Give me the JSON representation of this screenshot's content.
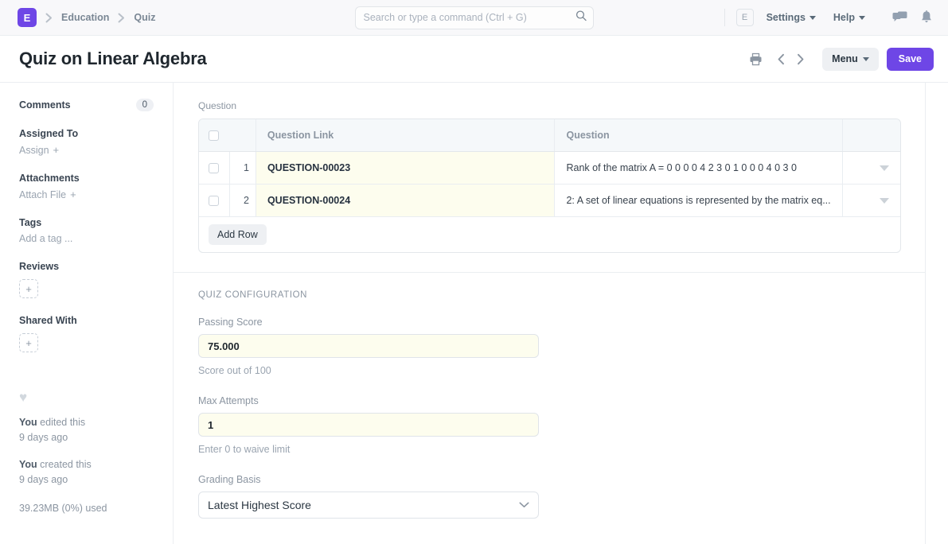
{
  "navbar": {
    "logo_letter": "E",
    "breadcrumbs": [
      {
        "label": "Education"
      },
      {
        "label": "Quiz"
      }
    ],
    "search": {
      "value": "",
      "placeholder": "Search or type a command (Ctrl + G)"
    },
    "avatar_letter": "E",
    "settings_label": "Settings",
    "help_label": "Help",
    "icons": [
      "search-icon",
      "chat-icon",
      "bell-icon"
    ]
  },
  "header": {
    "title": "Quiz on Linear Algebra",
    "print_icon": "printer-icon",
    "prev_icon": "chevron-left-icon",
    "next_icon": "chevron-right-icon",
    "menu_label": "Menu",
    "save_label": "Save",
    "accent_color": "#6e46e6"
  },
  "sidebar": {
    "comments_label": "Comments",
    "comments_count": "0",
    "assigned_to_label": "Assigned To",
    "assign_label": "Assign",
    "attachments_label": "Attachments",
    "attach_file_label": "Attach File",
    "tags_label": "Tags",
    "add_tag_label": "Add a tag ...",
    "reviews_label": "Reviews",
    "shared_with_label": "Shared With",
    "add_symbol": "+",
    "like_icon": "heart-icon",
    "activity": [
      {
        "actor": "You",
        "action": " edited this",
        "time": "9 days ago"
      },
      {
        "actor": "You",
        "action": " created this",
        "time": "9 days ago"
      }
    ],
    "storage": "39.23MB (0%) used"
  },
  "main": {
    "question_section": {
      "label": "Question",
      "columns": [
        "Question Link",
        "Question"
      ],
      "rows": [
        {
          "index": "1",
          "link": "QUESTION-00023",
          "question": "Rank of the matrix A = 0 0 0 0 4 2 3 0 1 0 0 0 4 0 3 0"
        },
        {
          "index": "2",
          "link": "QUESTION-00024",
          "question": "2: A set of linear equations is represented by the matrix eq..."
        }
      ],
      "add_row_label": "Add Row"
    },
    "quiz_configuration": {
      "title": "QUIZ CONFIGURATION",
      "passing_score": {
        "label": "Passing Score",
        "value": "75.000",
        "help": "Score out of 100"
      },
      "max_attempts": {
        "label": "Max Attempts",
        "value": "1",
        "help": "Enter 0 to waive limit"
      },
      "grading_basis": {
        "label": "Grading Basis",
        "value": "Latest Highest Score",
        "options": [
          "Latest Highest Score"
        ]
      }
    }
  }
}
